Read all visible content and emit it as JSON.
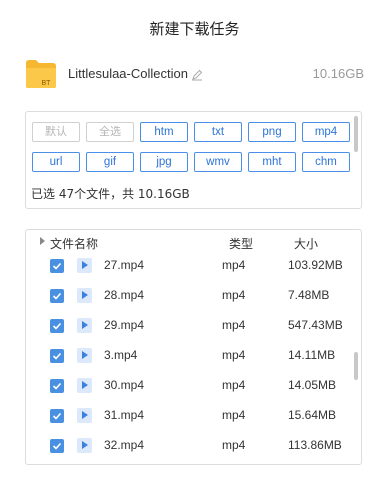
{
  "dialog": {
    "title": "新建下载任务"
  },
  "torrent": {
    "name": "Littlesulaa-Collection",
    "size": "10.16GB",
    "icon": "folder-bt-icon",
    "icon_badge": "BT"
  },
  "filters": {
    "buttons": [
      {
        "label": "默认",
        "enabled": false
      },
      {
        "label": "全选",
        "enabled": false
      },
      {
        "label": "htm",
        "enabled": true
      },
      {
        "label": "txt",
        "enabled": true
      },
      {
        "label": "png",
        "enabled": true
      },
      {
        "label": "mp4",
        "enabled": true
      },
      {
        "label": "url",
        "enabled": true
      },
      {
        "label": "gif",
        "enabled": true
      },
      {
        "label": "jpg",
        "enabled": true
      },
      {
        "label": "wmv",
        "enabled": true
      },
      {
        "label": "mht",
        "enabled": true
      },
      {
        "label": "chm",
        "enabled": true
      }
    ],
    "selected_info": "已选 47个文件，共 10.16GB"
  },
  "file_list": {
    "columns": {
      "name": "文件名称",
      "type": "类型",
      "size": "大小"
    },
    "rows": [
      {
        "name": "27.mp4",
        "type": "mp4",
        "size": "103.92MB",
        "checked": true
      },
      {
        "name": "28.mp4",
        "type": "mp4",
        "size": "7.48MB",
        "checked": true
      },
      {
        "name": "29.mp4",
        "type": "mp4",
        "size": "547.43MB",
        "checked": true
      },
      {
        "name": "3.mp4",
        "type": "mp4",
        "size": "14.11MB",
        "checked": true
      },
      {
        "name": "30.mp4",
        "type": "mp4",
        "size": "14.05MB",
        "checked": true
      },
      {
        "name": "31.mp4",
        "type": "mp4",
        "size": "15.64MB",
        "checked": true
      },
      {
        "name": "32.mp4",
        "type": "mp4",
        "size": "113.86MB",
        "checked": true
      }
    ]
  },
  "colors": {
    "accent": "#4a90e2",
    "border": "#dcdcdc",
    "folder": "#f5b830"
  }
}
